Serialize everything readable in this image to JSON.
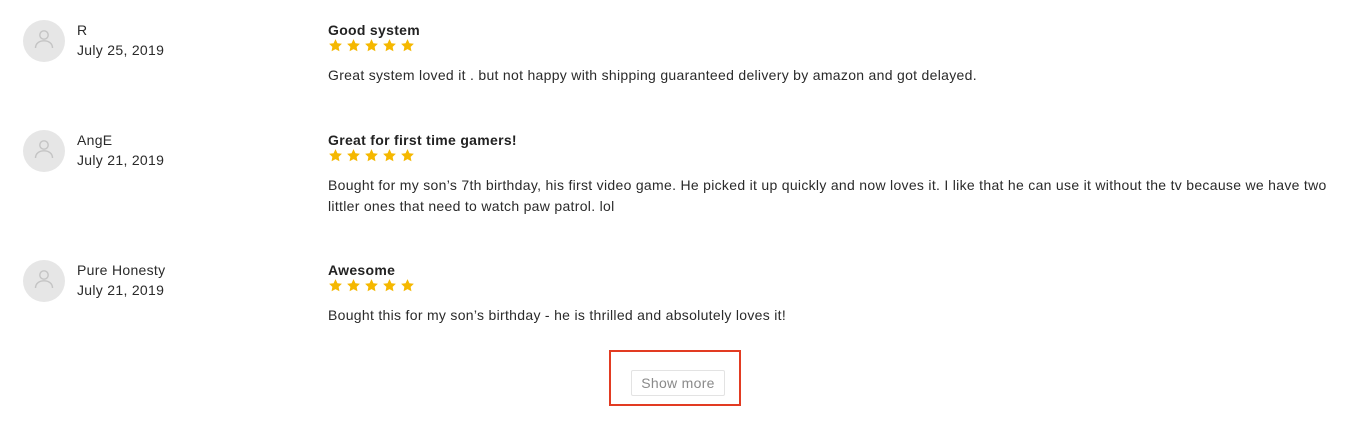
{
  "colors": {
    "star": "#f5b800",
    "highlight": "#e23b22",
    "avatar_bg": "#e6e6e6"
  },
  "icons": {
    "avatar": "user-icon",
    "star": "star-icon"
  },
  "reviews": [
    {
      "author": "R",
      "date": "July 25, 2019",
      "title": "Good system",
      "rating": 5,
      "text": "Great system loved it . but not happy with shipping guaranteed delivery by amazon and got delayed."
    },
    {
      "author": "AngE",
      "date": "July 21, 2019",
      "title": "Great for first time gamers!",
      "rating": 5,
      "text": "Bought for my son’s 7th birthday, his first video game. He picked it up quickly and now loves it. I like that he can use it without the tv because we have two littler ones that need to watch paw patrol. lol"
    },
    {
      "author": "Pure Honesty",
      "date": "July 21, 2019",
      "title": "Awesome",
      "rating": 5,
      "text": "Bought this for my son’s birthday - he is thrilled and absolutely loves it!"
    }
  ],
  "show_more_label": "Show more"
}
